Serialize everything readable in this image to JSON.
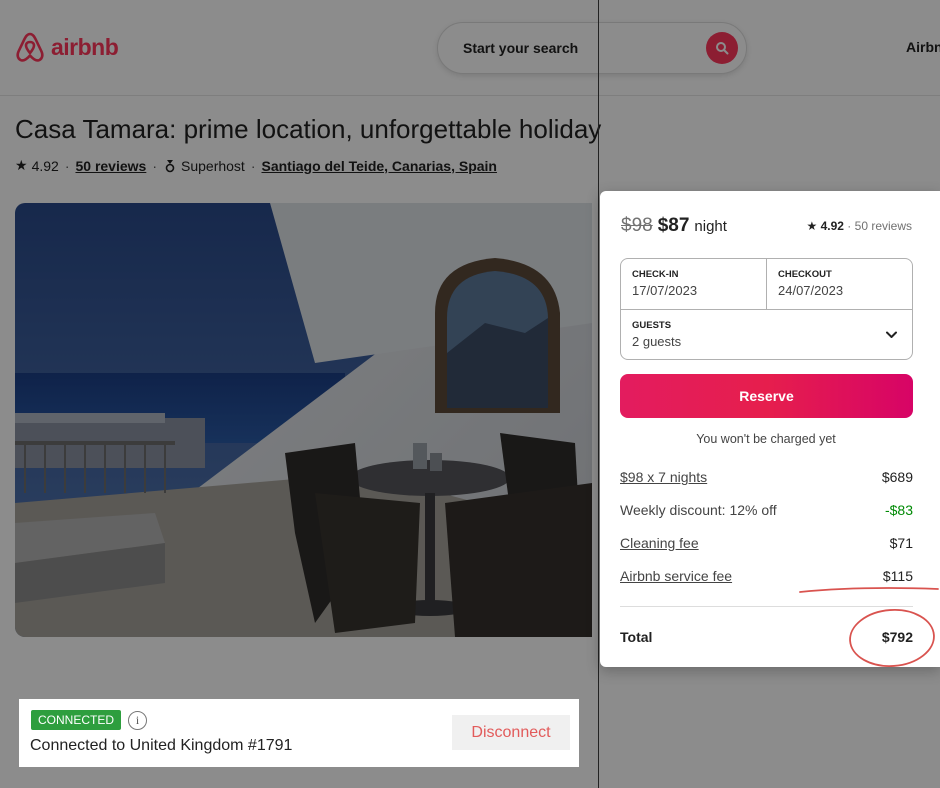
{
  "header": {
    "logo_text": "airbnb",
    "search_text": "Start your search",
    "right_text": "Airbn"
  },
  "listing": {
    "title": "Casa Tamara: prime location, unforgettable holiday",
    "rating": "4.92",
    "reviews_link": "50 reviews",
    "superhost": "Superhost",
    "location": "Santiago del Teide, Canarias, Spain",
    "photo_alt": "Terrace with table and chairs overlooking the sea"
  },
  "booking": {
    "old_price": "$98",
    "new_price": "$87",
    "per_night": "night",
    "rating": "4.92",
    "reviews": "50 reviews",
    "checkin_label": "CHECK-IN",
    "checkin_value": "17/07/2023",
    "checkout_label": "CHECKOUT",
    "checkout_value": "24/07/2023",
    "guests_label": "GUESTS",
    "guests_value": "2 guests",
    "reserve_label": "Reserve",
    "no_charge_note": "You won't be charged yet",
    "line_items": [
      {
        "label": "$98 x 7 nights",
        "amount": "$689"
      },
      {
        "label": "Weekly discount: 12% off",
        "amount": "-$83"
      },
      {
        "label": "Cleaning fee",
        "amount": "$71"
      },
      {
        "label": "Airbnb service fee",
        "amount": "$115"
      }
    ],
    "total_label": "Total",
    "total_amount": "$792"
  },
  "vpn": {
    "badge": "CONNECTED",
    "status": "Connected to United Kingdom #1791",
    "disconnect_label": "Disconnect"
  },
  "colors": {
    "brand": "#ff385c",
    "discount_green": "#008a05",
    "vpn_green": "#2e9e3e",
    "annotation_red": "#d9534f"
  }
}
